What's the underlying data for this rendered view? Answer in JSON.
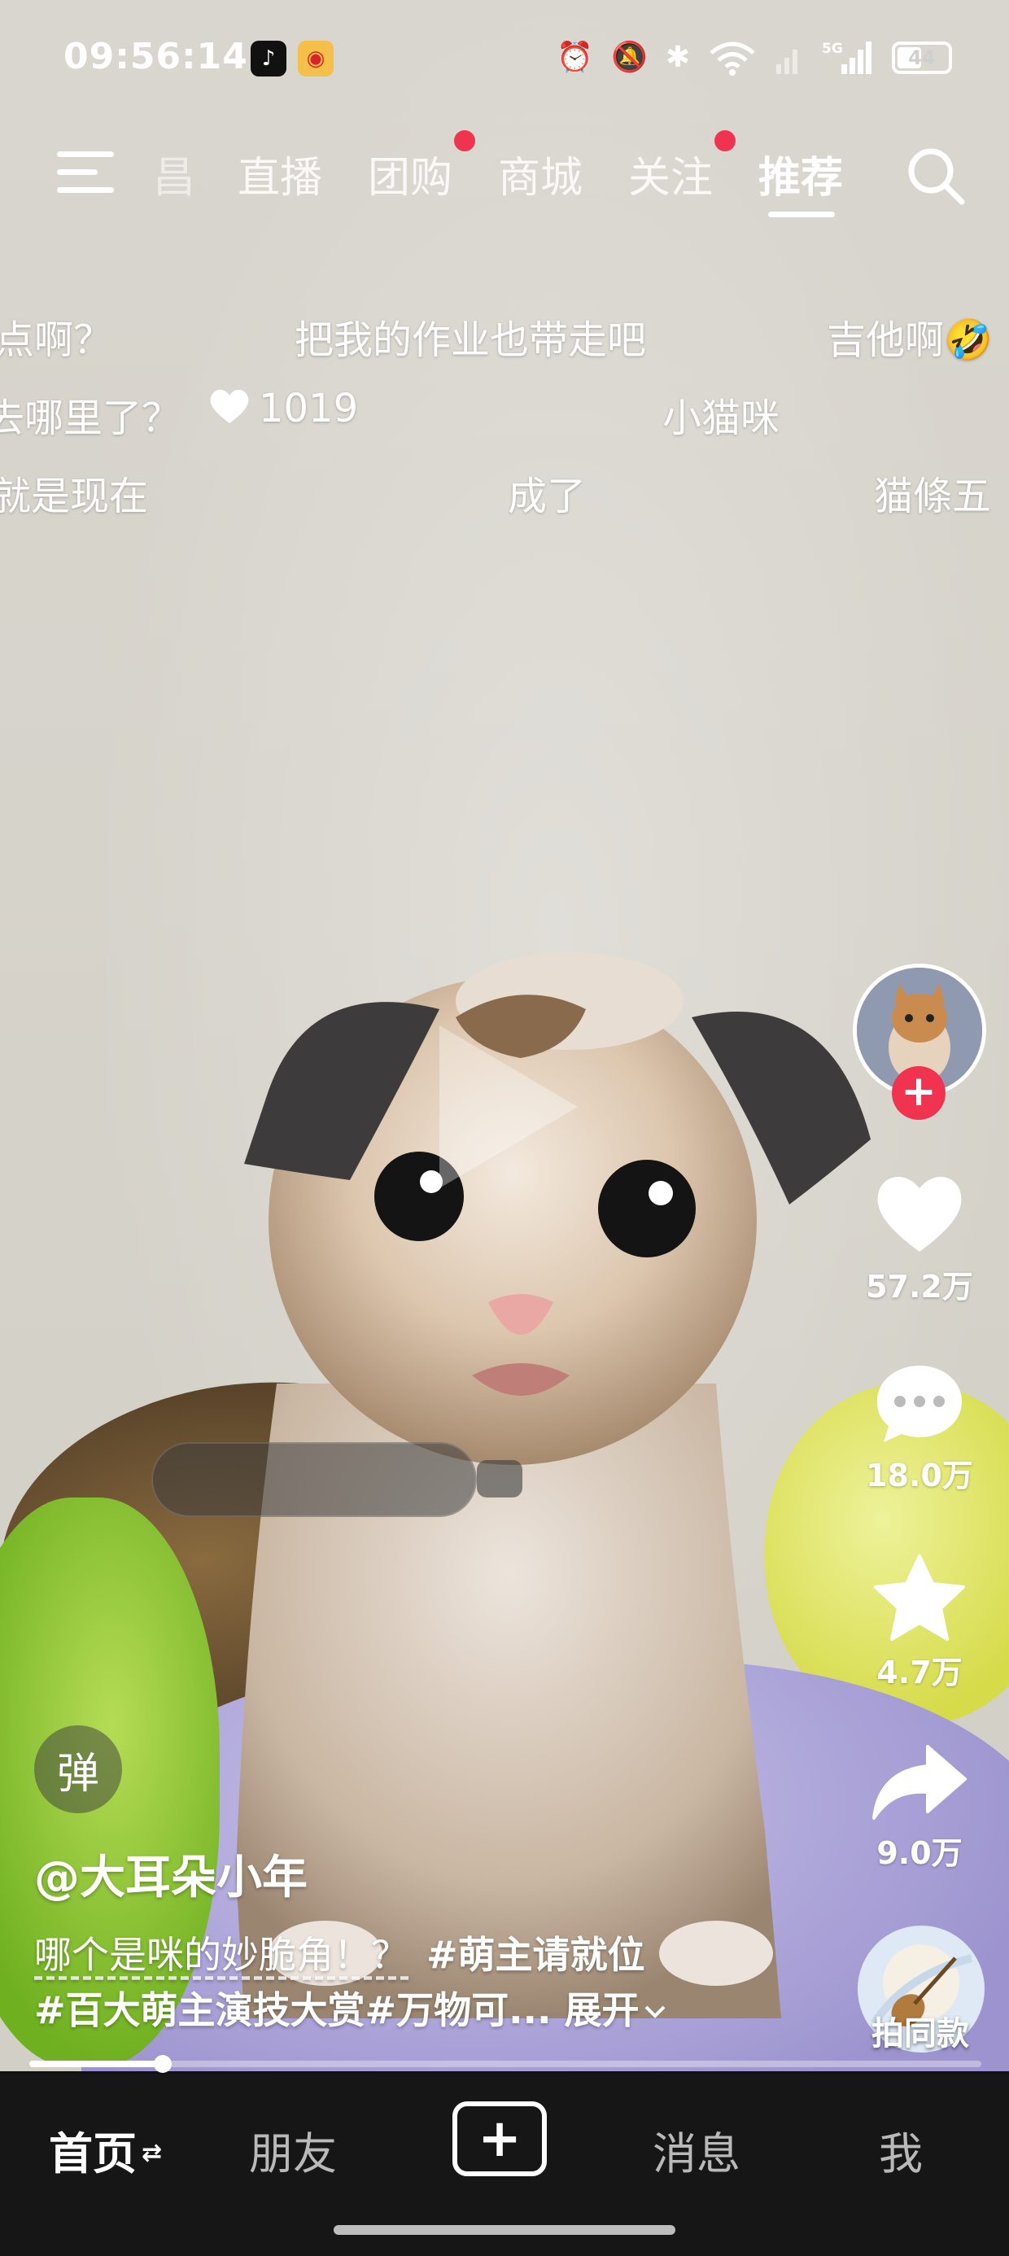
{
  "status_bar": {
    "time": "09:56:14",
    "battery": "44",
    "network": "5G"
  },
  "top_nav": {
    "tabs": [
      {
        "label": "昌",
        "active": false
      },
      {
        "label": "直播",
        "active": false
      },
      {
        "label": "团购",
        "active": false,
        "badge": true
      },
      {
        "label": "商城",
        "active": false
      },
      {
        "label": "关注",
        "active": false,
        "badge": true
      },
      {
        "label": "推荐",
        "active": true
      }
    ]
  },
  "danmaku": [
    {
      "text": "点啊？"
    },
    {
      "text": "把我的作业也带走吧"
    },
    {
      "text": "吉他啊🤣"
    },
    {
      "text": "去哪里了？"
    },
    {
      "text": "1019"
    },
    {
      "text": "小猫咪"
    },
    {
      "text": "就是现在"
    },
    {
      "text": "成了"
    },
    {
      "text": "猫條五"
    }
  ],
  "rail": {
    "likes": "57.2万",
    "comments": "18.0万",
    "favorites": "4.7万",
    "shares": "9.0万",
    "music_label": "拍同款"
  },
  "caption": {
    "danmaku_toggle": "弹",
    "author": "@大耳朵小年",
    "text": "哪个是咪的妙脆角！？",
    "tag1": "#萌主请就位",
    "line2": "#百大萌主演技大赏#万物可...",
    "expand": "展开"
  },
  "progress": {
    "fraction": 0.14
  },
  "bottom_nav": {
    "home": "首页",
    "friends": "朋友",
    "messages": "消息",
    "me": "我"
  },
  "colors": {
    "accent_red": "#f0344f",
    "nav_bg": "#161616"
  }
}
